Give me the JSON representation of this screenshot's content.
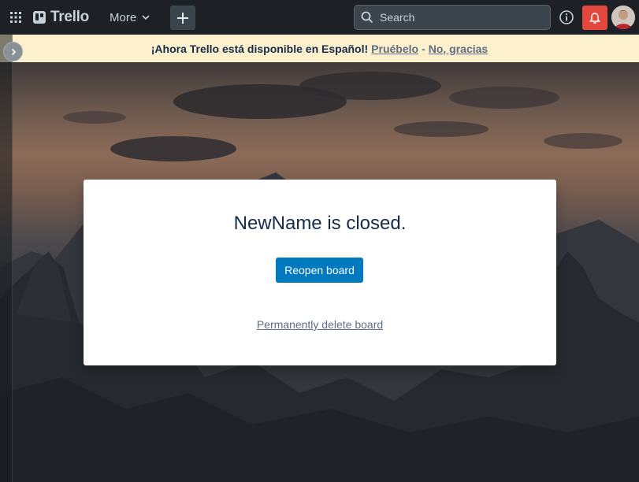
{
  "topbar": {
    "apps_icon": "grid-icon",
    "logo_text": "Trello",
    "more_label": "More",
    "create_icon": "plus-icon",
    "search_placeholder": "Search",
    "info_icon": "info-icon",
    "notifications_icon": "bell-icon",
    "colors": {
      "background": "#1d2125",
      "bell_bg": "#e2483d",
      "search_bg": "#3d454c"
    }
  },
  "banner": {
    "message": "¡Ahora Trello está disponible en Español!",
    "try_link": "Pruébelo",
    "separator": "-",
    "dismiss_link": "No, gracias",
    "background": "#fcf1cc"
  },
  "sidebar": {
    "toggle_icon": "chevron-right-icon"
  },
  "dialog": {
    "title": "NewName is closed.",
    "reopen_label": "Reopen board",
    "delete_label": "Permanently delete board",
    "accent": "#0079bf"
  }
}
